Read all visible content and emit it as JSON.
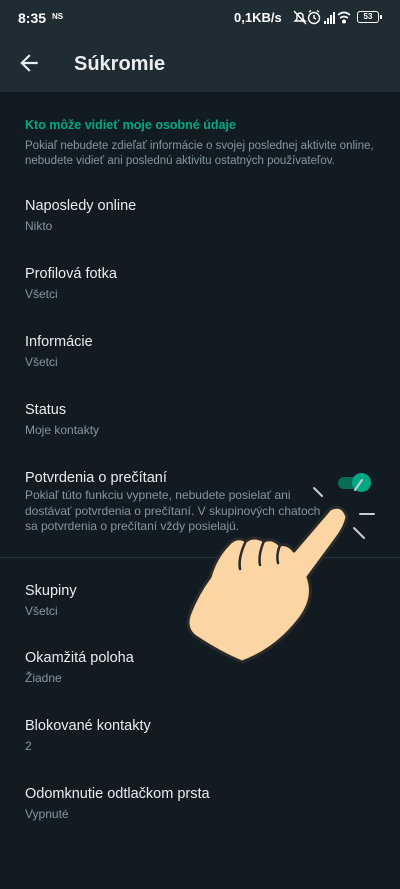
{
  "status_bar": {
    "time": "8:35",
    "ns_label": "NS",
    "speed": "0,1KB/s",
    "battery": "53",
    "icons": [
      "mute-icon",
      "alarm-icon",
      "signal-icon",
      "wifi-icon",
      "battery-icon"
    ]
  },
  "app_bar": {
    "title": "Súkromie",
    "back_icon": "arrow-back-icon"
  },
  "section": {
    "header": "Kto môže vidieť moje osobné údaje",
    "description": "Pokiaľ nebudete zdieľať informácie o svojej poslednej aktivite online, nebudete vidieť ani poslednú aktivitu ostatných používateľov."
  },
  "items": [
    {
      "label": "Naposledy online",
      "value": "Nikto"
    },
    {
      "label": "Profilová fotka",
      "value": "Všetci"
    },
    {
      "label": "Informácie",
      "value": "Všetci"
    },
    {
      "label": "Status",
      "value": "Moje kontakty"
    }
  ],
  "read_receipts": {
    "label": "Potvrdenia o prečítaní",
    "description": "Pokiaľ túto funkciu vypnete, nebudete posielať ani dostávať potvrdenia o prečítaní. V skupinových chatoch sa potvrdenia o prečítaní vždy posielajú.",
    "enabled": true
  },
  "items2": [
    {
      "label": "Skupiny",
      "value": "Všetci"
    },
    {
      "label": "Okamžitá poloha",
      "value": "Žiadne"
    },
    {
      "label": "Blokované kontakty",
      "value": "2"
    },
    {
      "label": "Odomknutie odtlačkom prsta",
      "value": "Vypnuté"
    }
  ],
  "colors": {
    "background": "#121b22",
    "app_bar": "#1f2c34",
    "accent": "#00a884",
    "secondary_text": "#8696a0"
  },
  "overlay": {
    "icon": "pointing-hand-icon"
  }
}
